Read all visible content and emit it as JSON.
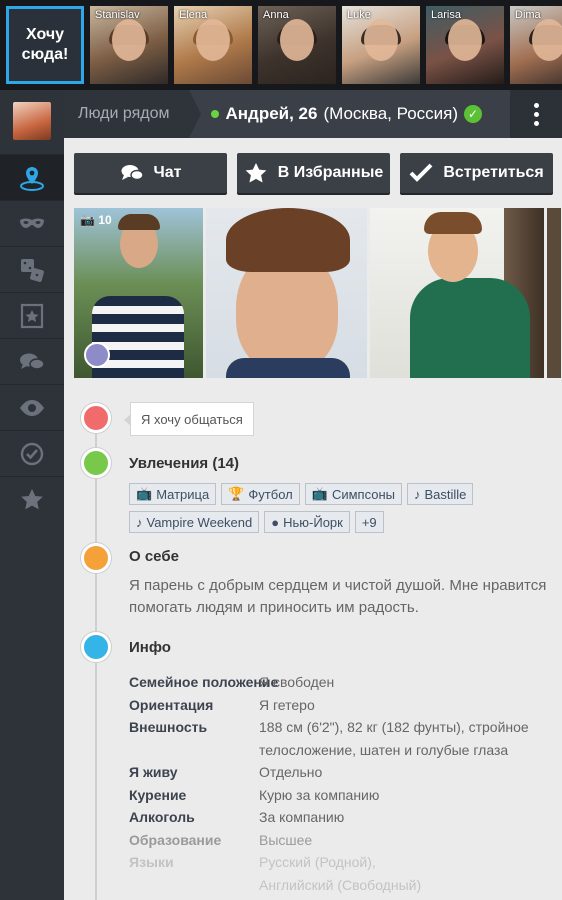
{
  "top_strip": {
    "cta_label": "Хочу сюда!",
    "people": [
      {
        "name": "Stanislav"
      },
      {
        "name": "Elena"
      },
      {
        "name": "Anna"
      },
      {
        "name": "Luke"
      },
      {
        "name": "Larisa"
      },
      {
        "name": "Dima"
      }
    ]
  },
  "header": {
    "breadcrumb": "Люди рядом",
    "profile_name": "Андрей, 26",
    "profile_location": "(Москва, Россия)"
  },
  "actions": {
    "chat": "Чат",
    "favorites": "В Избранные",
    "meet": "Встретиться"
  },
  "gallery": {
    "photo_count": "10"
  },
  "status": {
    "bubble": "Я хочу общаться"
  },
  "interests": {
    "title": "Увлечения (14)",
    "tags": [
      "Матрица",
      "Футбол",
      "Симпсоны",
      "Bastille",
      "Vampire Weekend",
      "Нью-Йорк",
      "+9"
    ]
  },
  "about": {
    "title": "О себе",
    "text": "Я парень с добрым сердцем и чистой душой. Мне нравится помогать людям и приносить им радость."
  },
  "info": {
    "title": "Инфо",
    "rows": [
      {
        "key": "Семейное положение",
        "value": "Я свободен"
      },
      {
        "key": "Ориентация",
        "value": "Я гетеро"
      },
      {
        "key": "Внешность",
        "value": "188 см (6'2\"), 82 кг (182 фунты), стройное телосложение, шатен и голубые глаза"
      },
      {
        "key": "Я живу",
        "value": "Отдельно"
      },
      {
        "key": "Курение",
        "value": "Курю за компанию"
      },
      {
        "key": "Алкоголь",
        "value": "За компанию"
      },
      {
        "key": "Образование",
        "value": "Высшее"
      },
      {
        "key": "Языки",
        "value": "Русский (Родной),"
      },
      {
        "key": "",
        "value": "Английский (Свободный)"
      }
    ]
  },
  "colors": {
    "accent": "#2ea7e7",
    "online": "#69d441",
    "verified": "#5bc236",
    "node_status": "#f06b6b",
    "node_interests": "#78c84a",
    "node_about": "#f5a13a",
    "node_info": "#35b5e7"
  }
}
